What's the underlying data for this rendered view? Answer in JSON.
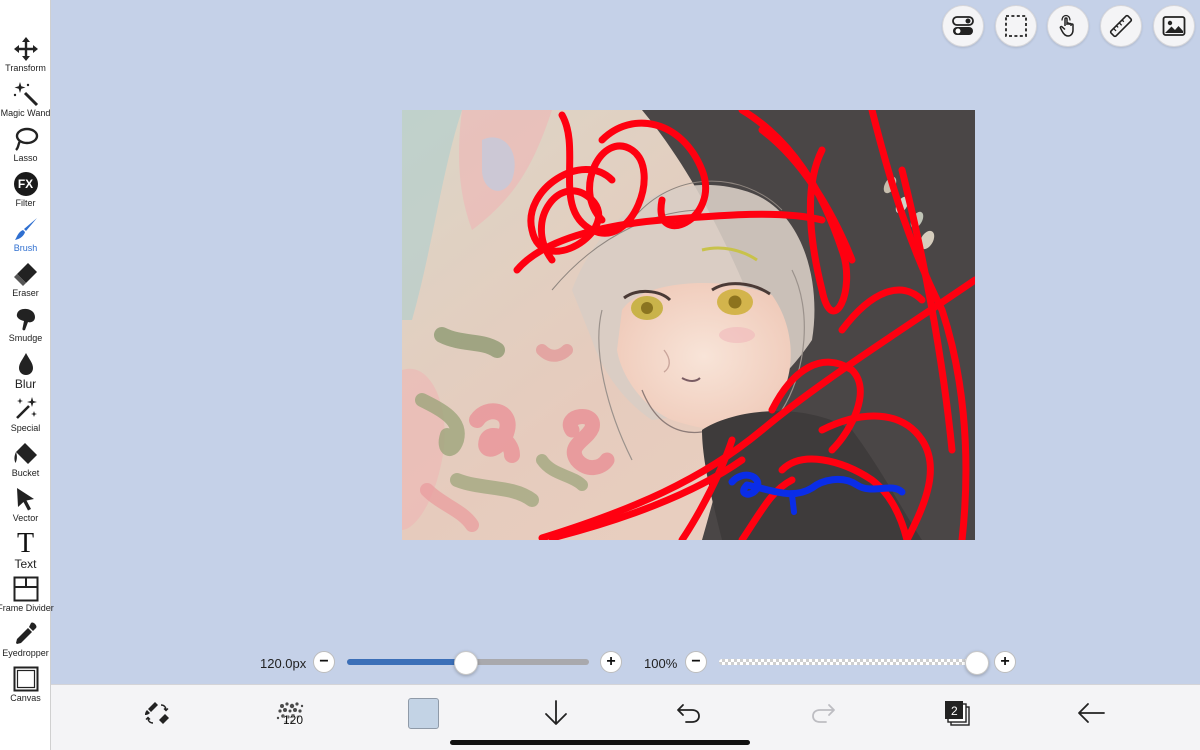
{
  "toolbar": {
    "tools": [
      {
        "label": "Transform",
        "icon": "transform-icon"
      },
      {
        "label": "Magic Wand",
        "icon": "magic-wand-icon"
      },
      {
        "label": "Lasso",
        "icon": "lasso-icon"
      },
      {
        "label": "Filter",
        "icon": "filter-fx-icon",
        "glyph": "FX"
      },
      {
        "label": "Brush",
        "icon": "brush-icon",
        "active": true
      },
      {
        "label": "Eraser",
        "icon": "eraser-icon"
      },
      {
        "label": "Smudge",
        "icon": "smudge-icon"
      },
      {
        "label": "Blur",
        "icon": "blur-drop-icon"
      },
      {
        "label": "Special",
        "icon": "special-sparkle-icon"
      },
      {
        "label": "Bucket",
        "icon": "bucket-icon"
      },
      {
        "label": "Vector",
        "icon": "vector-arrow-icon"
      },
      {
        "label": "Text",
        "icon": "text-icon",
        "glyph": "T"
      },
      {
        "label": "Frame Divider",
        "icon": "frame-divider-icon"
      },
      {
        "label": "Eyedropper",
        "icon": "eyedropper-icon"
      },
      {
        "label": "Canvas",
        "icon": "canvas-icon"
      }
    ]
  },
  "top_buttons": [
    "toggle-settings-icon",
    "selection-icon",
    "touch-gesture-icon",
    "ruler-icon",
    "material-image-icon"
  ],
  "sliders": {
    "brush_size": {
      "value_label": "120.0px",
      "fraction": 0.49
    },
    "opacity": {
      "value_label": "100%",
      "fraction": 1.0
    }
  },
  "bottom_bar": {
    "brush_size_badge": "120",
    "layer_count": "2",
    "current_color": "#c3d3e5"
  },
  "colors": {
    "background": "#c5d1e8",
    "accent": "#2f6fd0",
    "slider_fill": "#3b6fb8",
    "red_strokes": "#ff0010",
    "blue_stroke": "#0a2de8"
  }
}
